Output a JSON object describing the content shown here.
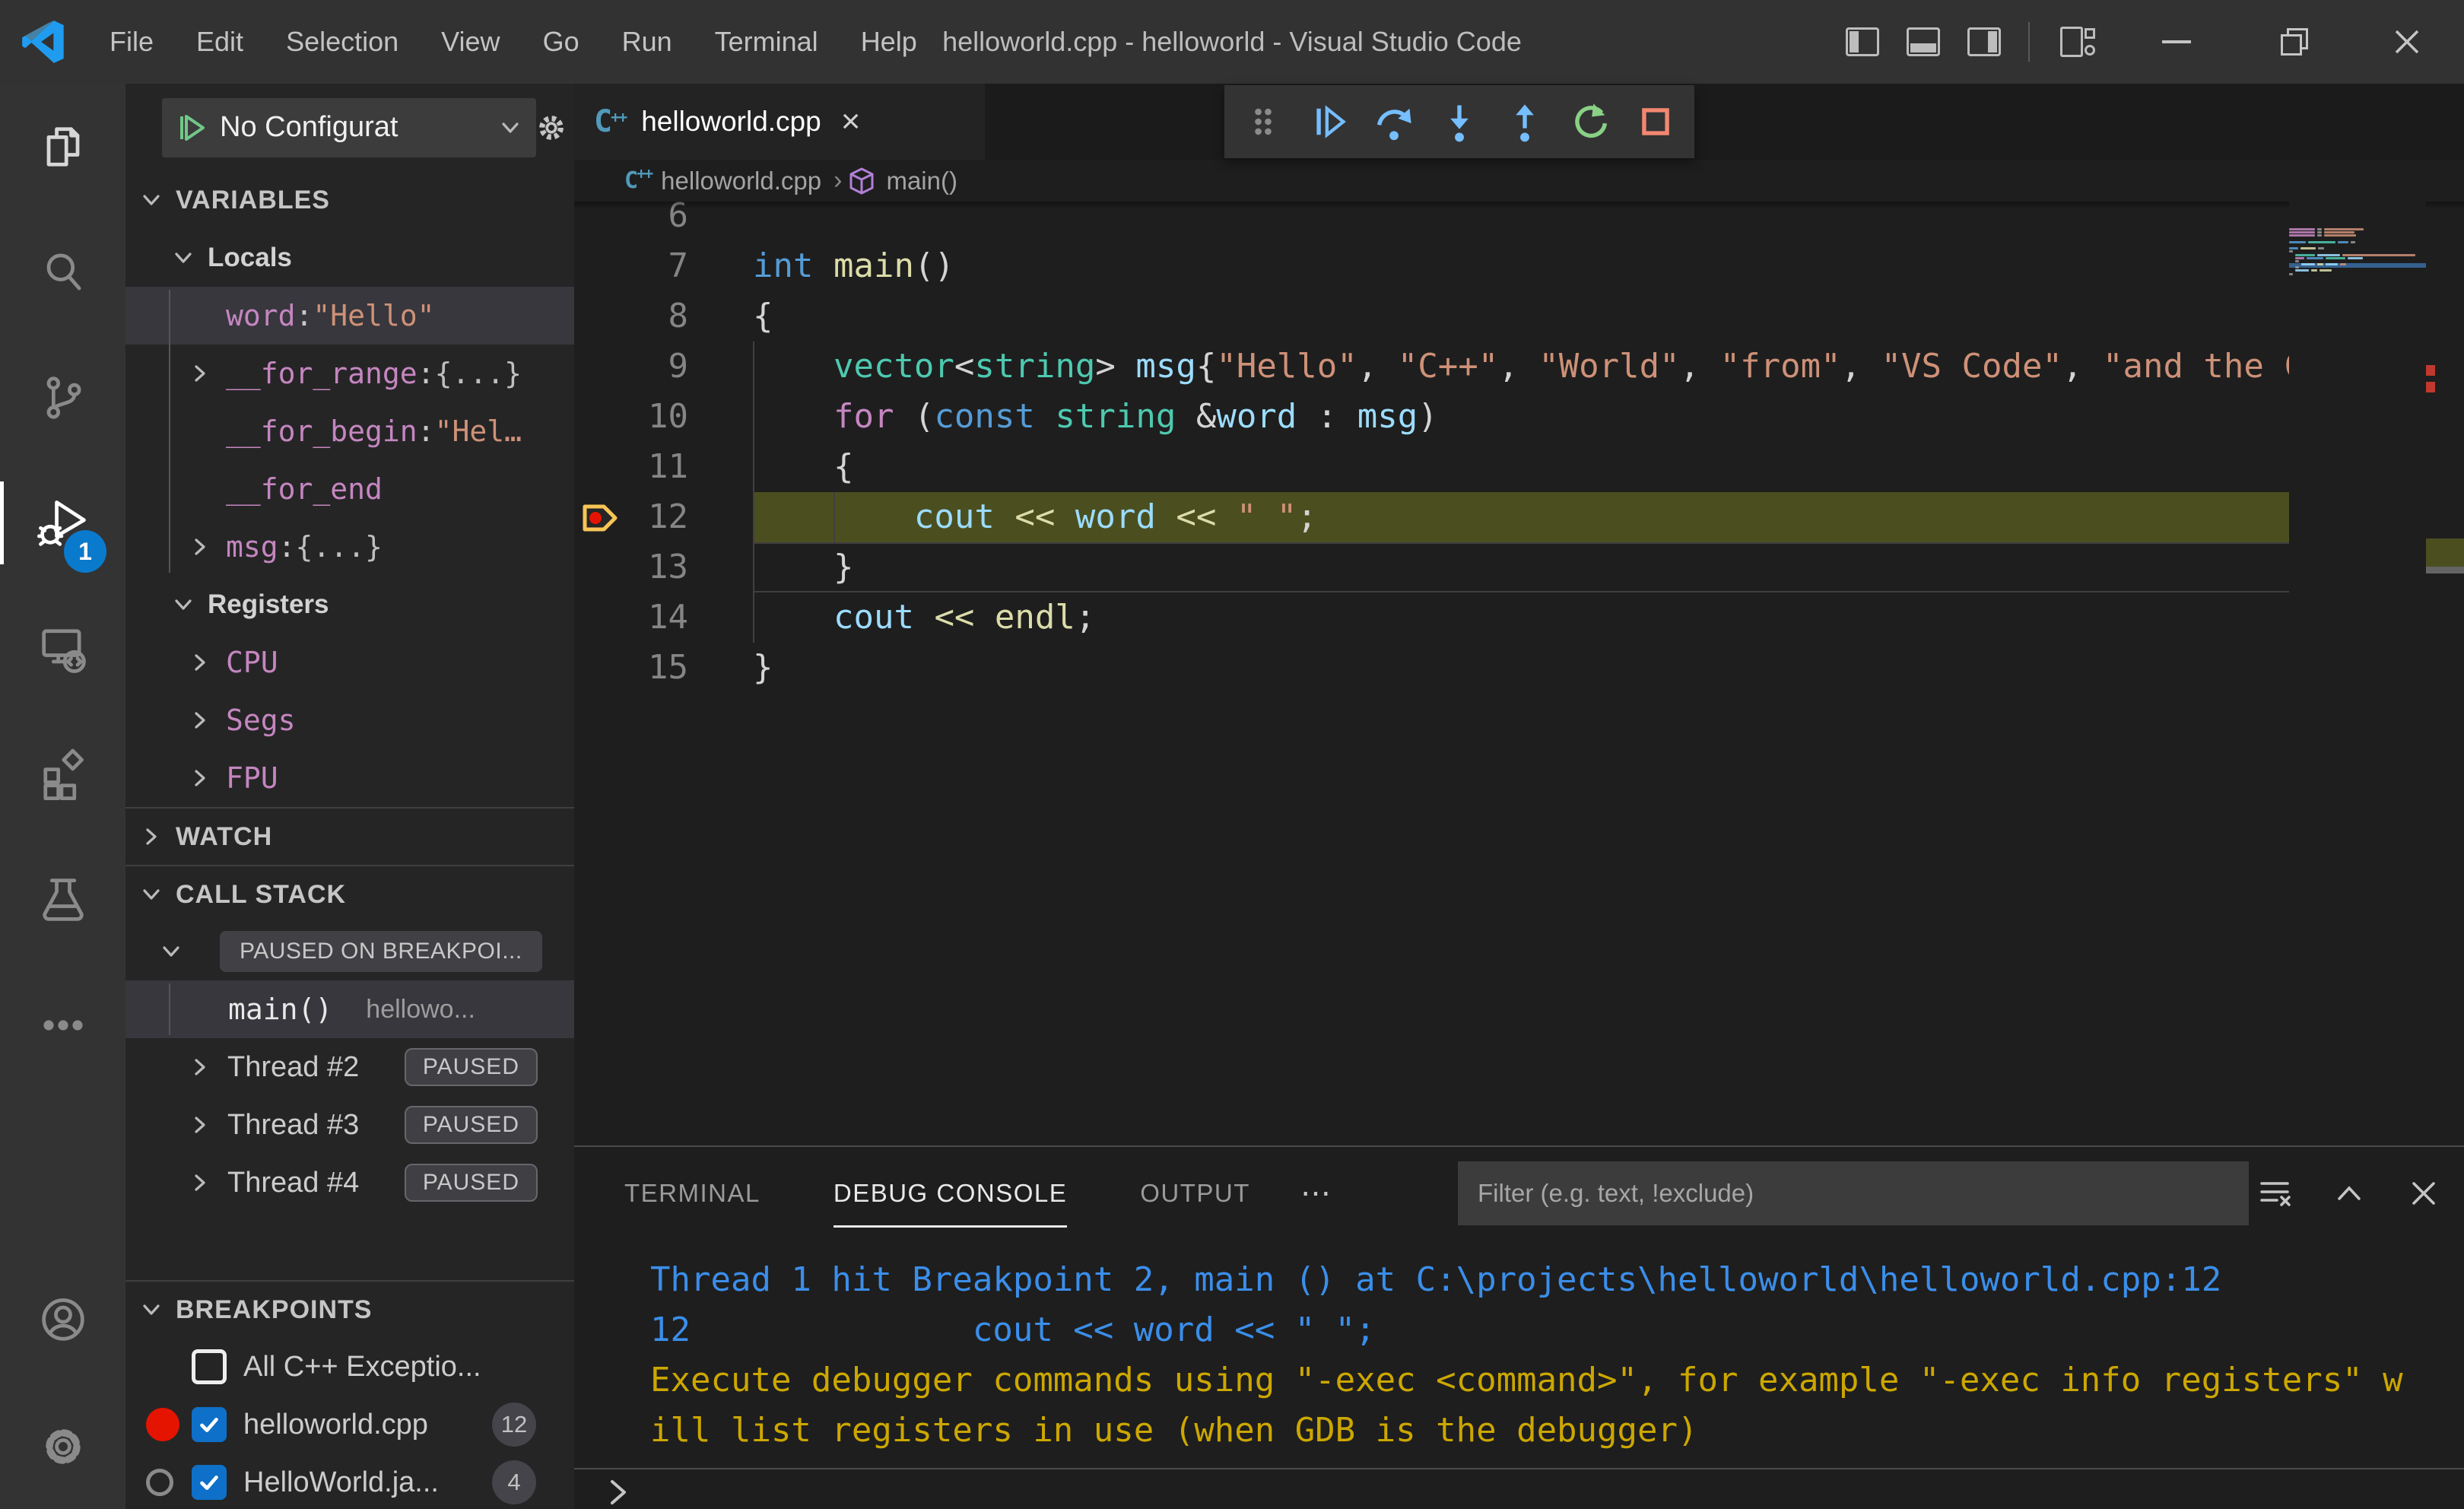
{
  "window": {
    "title": "helloworld.cpp - helloworld - Visual Studio Code",
    "menus": [
      "File",
      "Edit",
      "Selection",
      "View",
      "Go",
      "Run",
      "Terminal",
      "Help"
    ],
    "controls": [
      "toggle-primary-sidebar",
      "toggle-panel",
      "toggle-secondary-sidebar",
      "customize-layout",
      "minimize",
      "restore",
      "close"
    ]
  },
  "icons": {
    "cpp_c": "C",
    "cpp_pp": "++",
    "more_dots": "⋯"
  },
  "activity_bar": {
    "badge": "1",
    "items": [
      "explorer",
      "search",
      "source-control",
      "run-and-debug",
      "remote-explorer",
      "extensions",
      "testing",
      "more",
      "accounts",
      "settings"
    ]
  },
  "sidebar": {
    "config_dropdown": {
      "label": "No Configurat"
    },
    "variables": {
      "header": "VARIABLES",
      "scope": "Locals",
      "rows": [
        {
          "name": "word",
          "sep": ": ",
          "value": "\"Hello\"",
          "vcls": "str",
          "chevron": "",
          "selected": true
        },
        {
          "name": "__for_range",
          "sep": ": ",
          "value": "{...}",
          "vcls": "pl",
          "chevron": "right",
          "selected": false
        },
        {
          "name": "__for_begin",
          "sep": ": ",
          "value": "\"Hel…",
          "vcls": "str",
          "chevron": "",
          "selected": false
        },
        {
          "name": "__for_end",
          "sep": "",
          "value": "",
          "vcls": "pl",
          "chevron": "",
          "selected": false
        },
        {
          "name": "msg",
          "sep": ": ",
          "value": "{...}",
          "vcls": "pl",
          "chevron": "right",
          "selected": false
        }
      ],
      "registers": {
        "label": "Registers",
        "children": [
          "CPU",
          "Segs",
          "FPU"
        ]
      }
    },
    "watch": {
      "header": "WATCH"
    },
    "call_stack": {
      "header": "CALL STACK",
      "status_badge": "PAUSED ON BREAKPOI...",
      "frame": {
        "name": "main()",
        "file": "hellowo..."
      },
      "threads": [
        {
          "label": "Thread #2",
          "badge": "PAUSED"
        },
        {
          "label": "Thread #3",
          "badge": "PAUSED"
        },
        {
          "label": "Thread #4",
          "badge": "PAUSED"
        }
      ]
    },
    "breakpoints": {
      "header": "BREAKPOINTS",
      "rows": [
        {
          "marker": "none",
          "checked": false,
          "label": "All C++ Exceptio...",
          "count": ""
        },
        {
          "marker": "red-dot",
          "checked": true,
          "label": "helloworld.cpp",
          "count": "12"
        },
        {
          "marker": "gray-circle",
          "checked": true,
          "label": "HelloWorld.ja...",
          "count": "4"
        }
      ]
    }
  },
  "editor": {
    "tab": {
      "label": "helloworld.cpp"
    },
    "breadcrumb_file": "helloworld.cpp",
    "breadcrumb_symbol": "main()",
    "debug_toolbar": [
      "drag-handle",
      "continue",
      "step-over",
      "step-into",
      "step-out",
      "restart",
      "stop"
    ],
    "exec_line": 12,
    "cursor_line": 13,
    "code": {
      "lines": [
        {
          "num": 6,
          "tokens": []
        },
        {
          "num": 7,
          "tokens": [
            [
              "int",
              "kw"
            ],
            [
              " ",
              "pl"
            ],
            [
              "main",
              "fn"
            ],
            [
              "()",
              "pl"
            ]
          ]
        },
        {
          "num": 8,
          "tokens": [
            [
              "{",
              "pl"
            ]
          ]
        },
        {
          "num": 9,
          "tokens": [
            [
              "    ",
              "pl"
            ],
            [
              "vector",
              "type"
            ],
            [
              "<",
              "pl"
            ],
            [
              "string",
              "type"
            ],
            [
              "> ",
              "pl"
            ],
            [
              "msg",
              "var"
            ],
            [
              "{",
              "pl"
            ],
            [
              "\"Hello\"",
              "str"
            ],
            [
              ", ",
              "pl"
            ],
            [
              "\"C++\"",
              "str"
            ],
            [
              ", ",
              "pl"
            ],
            [
              "\"World\"",
              "str"
            ],
            [
              ", ",
              "pl"
            ],
            [
              "\"from\"",
              "str"
            ],
            [
              ", ",
              "pl"
            ],
            [
              "\"VS Code\"",
              "str"
            ],
            [
              ", ",
              "pl"
            ],
            [
              "\"and the C++ extension!\"",
              "str"
            ],
            [
              "};",
              "pl"
            ]
          ]
        },
        {
          "num": 10,
          "tokens": [
            [
              "    ",
              "pl"
            ],
            [
              "for",
              "ctrl"
            ],
            [
              " (",
              "pl"
            ],
            [
              "const",
              "kw"
            ],
            [
              " ",
              "pl"
            ],
            [
              "string",
              "type"
            ],
            [
              " &",
              "pl"
            ],
            [
              "word",
              "var"
            ],
            [
              " : ",
              "pl"
            ],
            [
              "msg",
              "var"
            ],
            [
              ")",
              "pl"
            ]
          ]
        },
        {
          "num": 11,
          "tokens": [
            [
              "    {",
              "pl"
            ]
          ]
        },
        {
          "num": 12,
          "tokens": [
            [
              "        ",
              "pl"
            ],
            [
              "cout",
              "var"
            ],
            [
              " ",
              "pl"
            ],
            [
              "<<",
              "fn"
            ],
            [
              " ",
              "pl"
            ],
            [
              "word",
              "var"
            ],
            [
              " ",
              "pl"
            ],
            [
              "<<",
              "fn"
            ],
            [
              " ",
              "pl"
            ],
            [
              "\" \"",
              "str"
            ],
            [
              ";",
              "pl"
            ]
          ]
        },
        {
          "num": 13,
          "tokens": [
            [
              "    }",
              "pl"
            ]
          ]
        },
        {
          "num": 14,
          "tokens": [
            [
              "    ",
              "pl"
            ],
            [
              "cout",
              "var"
            ],
            [
              " ",
              "pl"
            ],
            [
              "<<",
              "fn"
            ],
            [
              " ",
              "pl"
            ],
            [
              "endl",
              "fn"
            ],
            [
              ";",
              "pl"
            ]
          ]
        },
        {
          "num": 15,
          "tokens": [
            [
              "}",
              "pl"
            ]
          ]
        }
      ]
    },
    "minimap": {
      "rows": [
        [
          0,
          [
            [
              34,
              "p"
            ],
            [
              6,
              "g"
            ],
            [
              52,
              "o"
            ]
          ]
        ],
        [
          0,
          [
            [
              34,
              "p"
            ],
            [
              6,
              "g"
            ],
            [
              40,
              "o"
            ]
          ]
        ],
        [
          0,
          [
            [
              34,
              "p"
            ],
            [
              6,
              "g"
            ],
            [
              42,
              "o"
            ]
          ]
        ],
        [
          0,
          []
        ],
        [
          0,
          [
            [
              22,
              "b"
            ],
            [
              36,
              "t"
            ],
            [
              14,
              "b"
            ],
            [
              6,
              "g"
            ]
          ]
        ],
        [
          0,
          []
        ],
        [
          0,
          [
            [
              12,
              "b"
            ],
            [
              20,
              "y"
            ],
            [
              8,
              "g"
            ]
          ]
        ],
        [
          0,
          [
            [
              5,
              "g"
            ]
          ]
        ],
        [
          8,
          [
            [
              26,
              "t"
            ],
            [
              30,
              "lb"
            ],
            [
              96,
              "o"
            ]
          ]
        ],
        [
          8,
          [
            [
              12,
              "p"
            ],
            [
              22,
              "b"
            ],
            [
              26,
              "t"
            ],
            [
              20,
              "lb"
            ]
          ]
        ],
        [
          8,
          [
            [
              5,
              "g"
            ]
          ]
        ],
        [
          16,
          [
            [
              18,
              "lb"
            ],
            [
              8,
              "y"
            ],
            [
              16,
              "lb"
            ],
            [
              8,
              "o"
            ]
          ]
        ],
        [
          8,
          [
            [
              5,
              "g"
            ]
          ]
        ],
        [
          8,
          [
            [
              18,
              "lb"
            ],
            [
              8,
              "y"
            ],
            [
              16,
              "y"
            ]
          ]
        ],
        [
          0,
          [
            [
              5,
              "g"
            ]
          ]
        ]
      ]
    }
  },
  "panel": {
    "tabs": [
      {
        "label": "TERMINAL",
        "active": false
      },
      {
        "label": "DEBUG CONSOLE",
        "active": true
      },
      {
        "label": "OUTPUT",
        "active": false
      }
    ],
    "filter_placeholder": "Filter (e.g. text, !exclude)",
    "console": [
      {
        "color": "info",
        "text": "Thread 1 hit Breakpoint 2, main () at C:\\projects\\helloworld\\helloworld.cpp:12"
      },
      {
        "color": "info",
        "text": "12              cout << word << \" \";"
      },
      {
        "color": "warn",
        "text": "Execute debugger commands using \"-exec <command>\", for example \"-exec info registers\" w"
      },
      {
        "color": "warn",
        "text": "ill list registers in use (when GDB is the debugger)"
      }
    ]
  },
  "colors": {
    "accent": "#007acc",
    "exec_line_bg": "#4b4f20",
    "console_info": "#3b8eea",
    "console_warn": "#cca700",
    "breakpoint_red": "#e51400",
    "string": "#ce9178",
    "keyword": "#569cd6",
    "type": "#4ec9b0",
    "variable": "#9cdcfe",
    "control": "#c586c0",
    "function": "#dcdcaa"
  }
}
